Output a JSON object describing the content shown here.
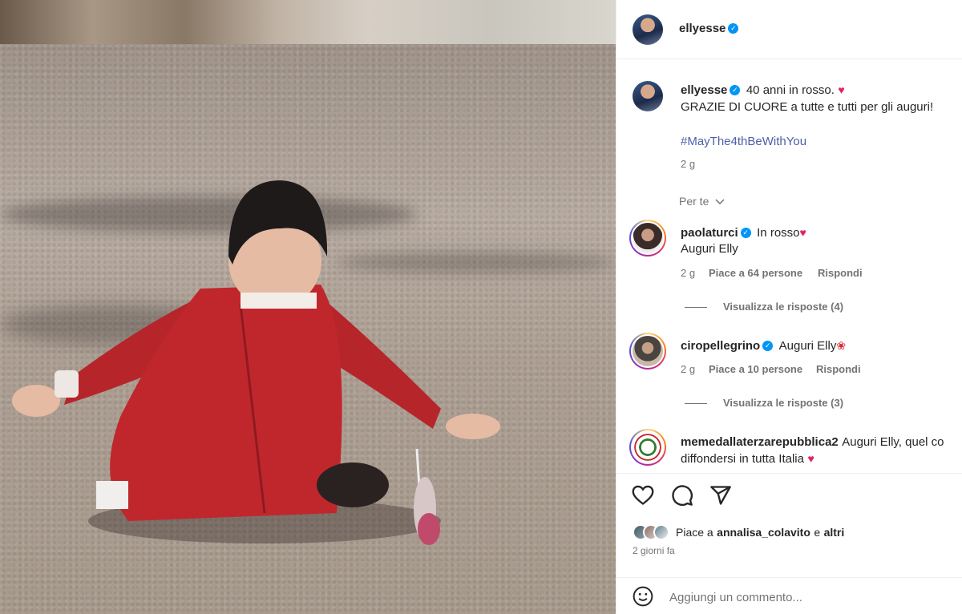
{
  "post": {
    "author": "ellyesse",
    "caption_line1": "40 anni in rosso.",
    "caption_line2": "GRAZIE DI CUORE a tutte e tutti per gli auguri!",
    "hashtag": "#MayThe4thBeWithYou",
    "caption_age": "2 g",
    "filter_label": "Per te"
  },
  "comments": [
    {
      "username": "paolaturci",
      "text_line1": "In rosso",
      "text_line2": "Auguri Elly",
      "age": "2 g",
      "likes": "Piace a 64 persone",
      "reply_label": "Rispondi",
      "view_replies": "Visualizza le risposte (4)"
    },
    {
      "username": "ciropellegrino",
      "text_line1": "Auguri Elly",
      "age": "2 g",
      "likes": "Piace a 10 persone",
      "reply_label": "Rispondi",
      "view_replies": "Visualizza le risposte (3)"
    },
    {
      "username": "memedallaterzarepubblica2",
      "text_line1": "Auguri Elly, quel co",
      "text_line2": "diffondersi in tutta Italia"
    }
  ],
  "likes": {
    "prefix": "Piace a",
    "user": "annalisa_colavito",
    "conj": "e",
    "others": "altri",
    "date": "2 giorni fa"
  },
  "comment_input": {
    "placeholder": "Aggiungi un commento..."
  },
  "icons": {
    "like": "heart-icon",
    "comment": "comment-icon",
    "share": "share-icon",
    "emoji": "emoji-icon",
    "verified": "verified-badge-icon",
    "chevron": "chevron-down-icon"
  },
  "colors": {
    "verified": "#0095f6",
    "hashtag": "#4b5fa8",
    "secondary": "#737373"
  }
}
